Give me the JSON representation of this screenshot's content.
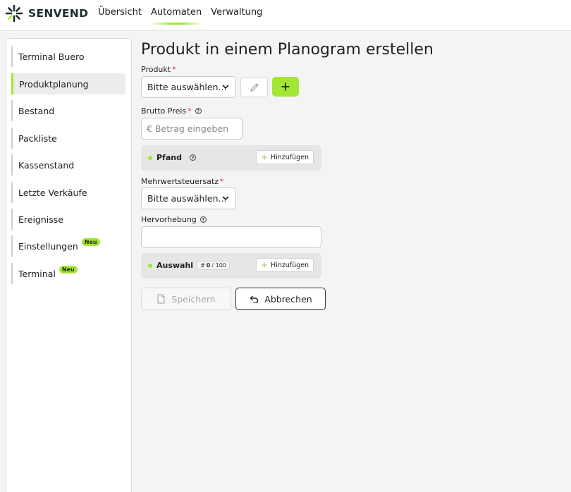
{
  "brand": {
    "name": "SENVEND",
    "accent": "#a3e635"
  },
  "nav": {
    "items": [
      "Übersicht",
      "Automaten",
      "Verwaltung"
    ],
    "active": "Automaten"
  },
  "sidebar": {
    "items": [
      {
        "label": "Terminal Buero"
      },
      {
        "label": "Produktplanung",
        "active": true
      },
      {
        "label": "Bestand"
      },
      {
        "label": "Packliste"
      },
      {
        "label": "Kassenstand"
      },
      {
        "label": "Letzte Verkäufe"
      },
      {
        "label": "Ereignisse"
      },
      {
        "label": "Einstellungen",
        "badge": "Neu"
      },
      {
        "label": "Terminal",
        "badge": "Neu"
      }
    ]
  },
  "form": {
    "title": "Produkt in einem Planogram erstellen",
    "produkt": {
      "label": "Produkt",
      "required": "*",
      "value": "Bitte auswählen..."
    },
    "brutto_preis": {
      "label": "Brutto Preis",
      "required": "*",
      "placeholder": "€ Betrag eingeben"
    },
    "pfand": {
      "label": "Pfand",
      "add_label": "Hinzufügen"
    },
    "mwst": {
      "label": "Mehrwertsteuersatz",
      "required": "*",
      "value": "Bitte auswählen..."
    },
    "hervorhebung": {
      "label": "Hervorhebung",
      "value": ""
    },
    "auswahl": {
      "label": "Auswahl",
      "count": "0",
      "max": "/ 100",
      "add_label": "Hinzufügen"
    },
    "save_label": "Speichern",
    "cancel_label": "Abbrechen"
  }
}
